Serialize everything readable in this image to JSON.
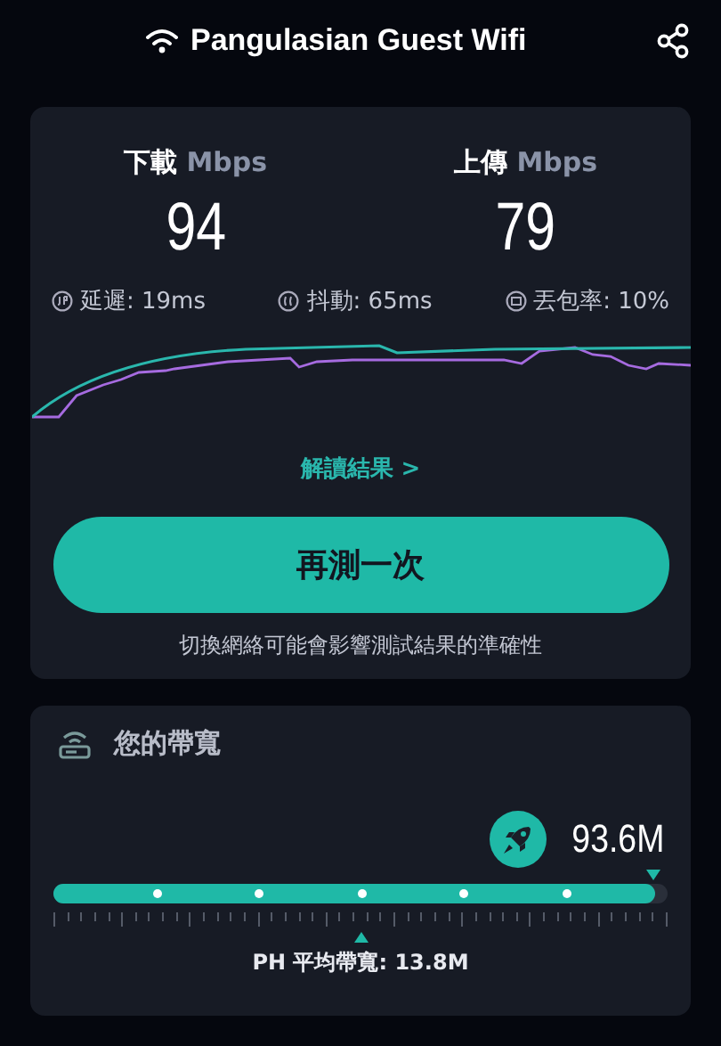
{
  "header": {
    "title": "Pangulasian Guest Wifi"
  },
  "results": {
    "speeds": [
      {
        "label": "下載",
        "unit": "Mbps",
        "value": "94"
      },
      {
        "label": "上傳",
        "unit": "Mbps",
        "value": "79"
      }
    ],
    "metrics": [
      {
        "kind": "latency",
        "label": "延遲: 19ms"
      },
      {
        "kind": "jitter",
        "label": "抖動: 65ms"
      },
      {
        "kind": "loss",
        "label": "丟包率: 10%"
      }
    ],
    "details_link": "解讀結果 >",
    "retest_button": "再測一次",
    "note": "切換網絡可能會影響測試結果的準確性"
  },
  "bandwidth": {
    "title": "您的帶寬",
    "value": "93.6M",
    "level": 0.98,
    "average": "PH 平均帶寬: 13.8M"
  }
}
